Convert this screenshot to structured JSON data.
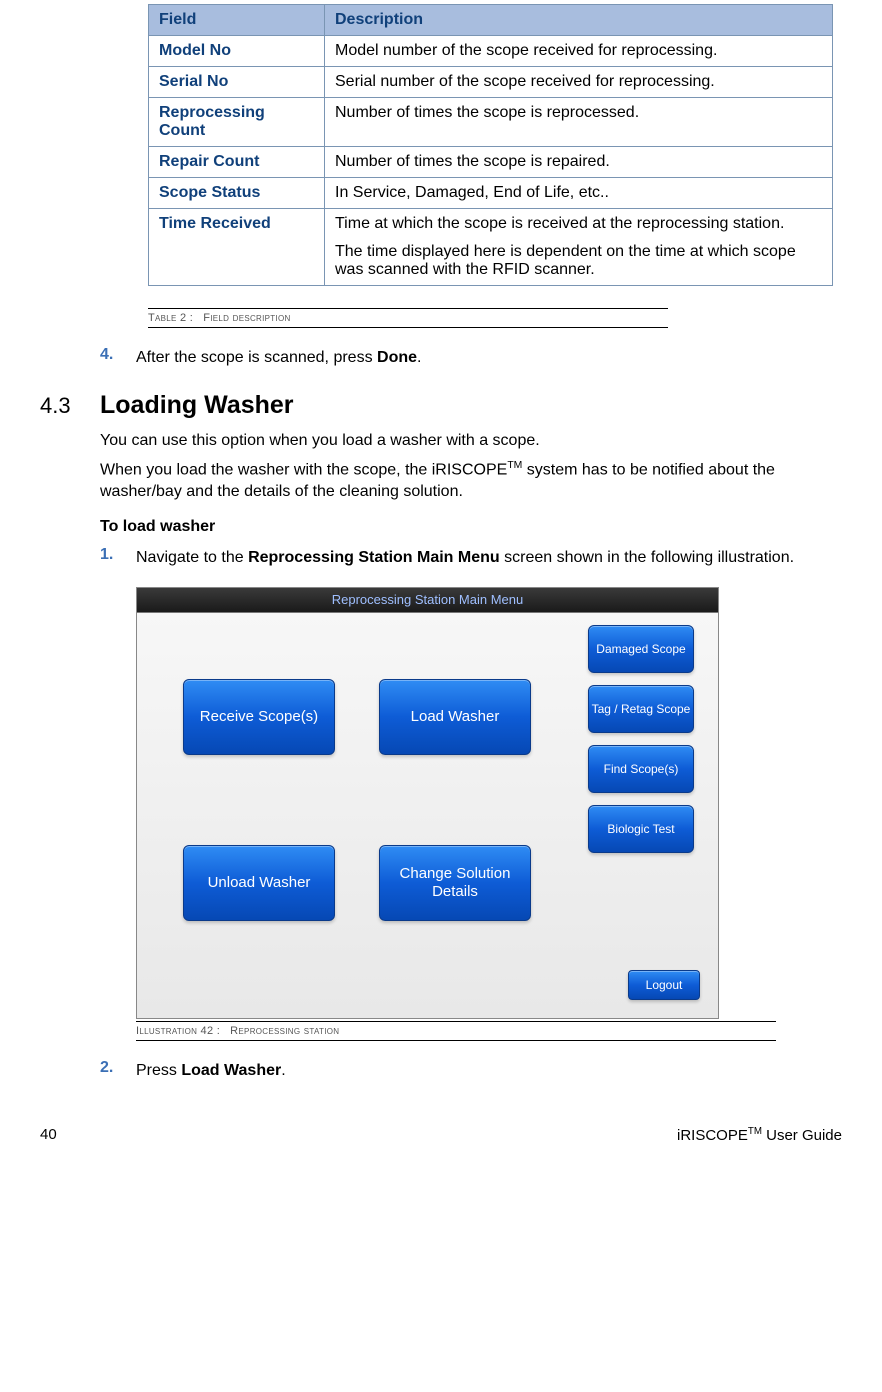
{
  "table": {
    "headers": [
      "Field",
      "Description"
    ],
    "rows": [
      {
        "field": "Model No",
        "desc": "Model number of the scope received for reprocessing."
      },
      {
        "field": "Serial No",
        "desc": "Serial number of the scope received for reprocessing."
      },
      {
        "field": "Reprocessing Count",
        "desc": "Number of times the scope is reprocessed."
      },
      {
        "field": "Repair Count",
        "desc": "Number of times the scope is repaired."
      },
      {
        "field": "Scope Status",
        "desc": "In Service, Damaged, End of Life, etc.."
      },
      {
        "field": "Time Received",
        "desc": "Time at which the scope is received at the reprocessing station.\nThe time displayed here is dependent on the time at which scope was scanned with the RFID scanner."
      }
    ]
  },
  "table_caption_prefix": "Table 2 :",
  "table_caption_text": "Field description",
  "step4_num": "4.",
  "step4_pre": "After the scope is scanned, press ",
  "step4_bold": "Done",
  "step4_post": ".",
  "section_num": "4.3",
  "section_title": "Loading Washer",
  "para1": "You can use this option when you load a washer with a scope.",
  "para2_pre": "When you load the washer with the scope, the iRISCOPE",
  "para2_tm": "TM",
  "para2_post": " system has to be notified about the washer/bay and the details of the cleaning solution.",
  "subhead": "To load washer",
  "step1_num": "1.",
  "step1_pre": "Navigate to the ",
  "step1_bold": "Reprocessing Station Main Menu",
  "step1_post": " screen shown in the following illustration.",
  "illus": {
    "titlebar": "Reprocessing Station Main Menu",
    "receive": "Receive Scope(s)",
    "load": "Load Washer",
    "unload": "Unload Washer",
    "change": "Change Solution Details",
    "damaged": "Damaged Scope",
    "tag": "Tag / Retag Scope",
    "find": "Find Scope(s)",
    "biologic": "Biologic Test",
    "logout": "Logout"
  },
  "illus_caption_prefix": "Illustration 42 :",
  "illus_caption_text": "Reprocessing station",
  "step2_num": "2.",
  "step2_pre": "Press ",
  "step2_bold": "Load Washer",
  "step2_post": ".",
  "footer_page": "40",
  "footer_brand": "iRISCOPE",
  "footer_tm": "TM",
  "footer_tail": " User Guide"
}
